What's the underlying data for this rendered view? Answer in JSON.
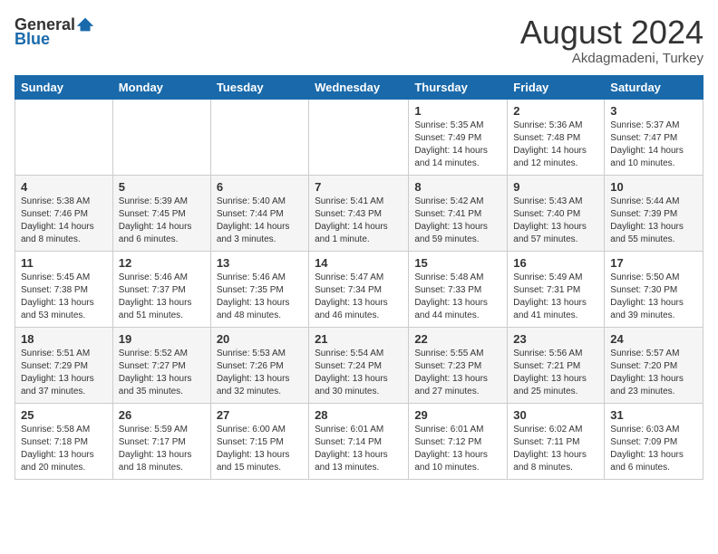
{
  "logo": {
    "text_general": "General",
    "text_blue": "Blue"
  },
  "title": {
    "month_year": "August 2024",
    "location": "Akdagmadeni, Turkey"
  },
  "weekdays": [
    "Sunday",
    "Monday",
    "Tuesday",
    "Wednesday",
    "Thursday",
    "Friday",
    "Saturday"
  ],
  "weeks": [
    [
      {
        "day": "",
        "sunrise": "",
        "sunset": "",
        "daylight": ""
      },
      {
        "day": "",
        "sunrise": "",
        "sunset": "",
        "daylight": ""
      },
      {
        "day": "",
        "sunrise": "",
        "sunset": "",
        "daylight": ""
      },
      {
        "day": "",
        "sunrise": "",
        "sunset": "",
        "daylight": ""
      },
      {
        "day": "1",
        "sunrise": "Sunrise: 5:35 AM",
        "sunset": "Sunset: 7:49 PM",
        "daylight": "Daylight: 14 hours and 14 minutes."
      },
      {
        "day": "2",
        "sunrise": "Sunrise: 5:36 AM",
        "sunset": "Sunset: 7:48 PM",
        "daylight": "Daylight: 14 hours and 12 minutes."
      },
      {
        "day": "3",
        "sunrise": "Sunrise: 5:37 AM",
        "sunset": "Sunset: 7:47 PM",
        "daylight": "Daylight: 14 hours and 10 minutes."
      }
    ],
    [
      {
        "day": "4",
        "sunrise": "Sunrise: 5:38 AM",
        "sunset": "Sunset: 7:46 PM",
        "daylight": "Daylight: 14 hours and 8 minutes."
      },
      {
        "day": "5",
        "sunrise": "Sunrise: 5:39 AM",
        "sunset": "Sunset: 7:45 PM",
        "daylight": "Daylight: 14 hours and 6 minutes."
      },
      {
        "day": "6",
        "sunrise": "Sunrise: 5:40 AM",
        "sunset": "Sunset: 7:44 PM",
        "daylight": "Daylight: 14 hours and 3 minutes."
      },
      {
        "day": "7",
        "sunrise": "Sunrise: 5:41 AM",
        "sunset": "Sunset: 7:43 PM",
        "daylight": "Daylight: 14 hours and 1 minute."
      },
      {
        "day": "8",
        "sunrise": "Sunrise: 5:42 AM",
        "sunset": "Sunset: 7:41 PM",
        "daylight": "Daylight: 13 hours and 59 minutes."
      },
      {
        "day": "9",
        "sunrise": "Sunrise: 5:43 AM",
        "sunset": "Sunset: 7:40 PM",
        "daylight": "Daylight: 13 hours and 57 minutes."
      },
      {
        "day": "10",
        "sunrise": "Sunrise: 5:44 AM",
        "sunset": "Sunset: 7:39 PM",
        "daylight": "Daylight: 13 hours and 55 minutes."
      }
    ],
    [
      {
        "day": "11",
        "sunrise": "Sunrise: 5:45 AM",
        "sunset": "Sunset: 7:38 PM",
        "daylight": "Daylight: 13 hours and 53 minutes."
      },
      {
        "day": "12",
        "sunrise": "Sunrise: 5:46 AM",
        "sunset": "Sunset: 7:37 PM",
        "daylight": "Daylight: 13 hours and 51 minutes."
      },
      {
        "day": "13",
        "sunrise": "Sunrise: 5:46 AM",
        "sunset": "Sunset: 7:35 PM",
        "daylight": "Daylight: 13 hours and 48 minutes."
      },
      {
        "day": "14",
        "sunrise": "Sunrise: 5:47 AM",
        "sunset": "Sunset: 7:34 PM",
        "daylight": "Daylight: 13 hours and 46 minutes."
      },
      {
        "day": "15",
        "sunrise": "Sunrise: 5:48 AM",
        "sunset": "Sunset: 7:33 PM",
        "daylight": "Daylight: 13 hours and 44 minutes."
      },
      {
        "day": "16",
        "sunrise": "Sunrise: 5:49 AM",
        "sunset": "Sunset: 7:31 PM",
        "daylight": "Daylight: 13 hours and 41 minutes."
      },
      {
        "day": "17",
        "sunrise": "Sunrise: 5:50 AM",
        "sunset": "Sunset: 7:30 PM",
        "daylight": "Daylight: 13 hours and 39 minutes."
      }
    ],
    [
      {
        "day": "18",
        "sunrise": "Sunrise: 5:51 AM",
        "sunset": "Sunset: 7:29 PM",
        "daylight": "Daylight: 13 hours and 37 minutes."
      },
      {
        "day": "19",
        "sunrise": "Sunrise: 5:52 AM",
        "sunset": "Sunset: 7:27 PM",
        "daylight": "Daylight: 13 hours and 35 minutes."
      },
      {
        "day": "20",
        "sunrise": "Sunrise: 5:53 AM",
        "sunset": "Sunset: 7:26 PM",
        "daylight": "Daylight: 13 hours and 32 minutes."
      },
      {
        "day": "21",
        "sunrise": "Sunrise: 5:54 AM",
        "sunset": "Sunset: 7:24 PM",
        "daylight": "Daylight: 13 hours and 30 minutes."
      },
      {
        "day": "22",
        "sunrise": "Sunrise: 5:55 AM",
        "sunset": "Sunset: 7:23 PM",
        "daylight": "Daylight: 13 hours and 27 minutes."
      },
      {
        "day": "23",
        "sunrise": "Sunrise: 5:56 AM",
        "sunset": "Sunset: 7:21 PM",
        "daylight": "Daylight: 13 hours and 25 minutes."
      },
      {
        "day": "24",
        "sunrise": "Sunrise: 5:57 AM",
        "sunset": "Sunset: 7:20 PM",
        "daylight": "Daylight: 13 hours and 23 minutes."
      }
    ],
    [
      {
        "day": "25",
        "sunrise": "Sunrise: 5:58 AM",
        "sunset": "Sunset: 7:18 PM",
        "daylight": "Daylight: 13 hours and 20 minutes."
      },
      {
        "day": "26",
        "sunrise": "Sunrise: 5:59 AM",
        "sunset": "Sunset: 7:17 PM",
        "daylight": "Daylight: 13 hours and 18 minutes."
      },
      {
        "day": "27",
        "sunrise": "Sunrise: 6:00 AM",
        "sunset": "Sunset: 7:15 PM",
        "daylight": "Daylight: 13 hours and 15 minutes."
      },
      {
        "day": "28",
        "sunrise": "Sunrise: 6:01 AM",
        "sunset": "Sunset: 7:14 PM",
        "daylight": "Daylight: 13 hours and 13 minutes."
      },
      {
        "day": "29",
        "sunrise": "Sunrise: 6:01 AM",
        "sunset": "Sunset: 7:12 PM",
        "daylight": "Daylight: 13 hours and 10 minutes."
      },
      {
        "day": "30",
        "sunrise": "Sunrise: 6:02 AM",
        "sunset": "Sunset: 7:11 PM",
        "daylight": "Daylight: 13 hours and 8 minutes."
      },
      {
        "day": "31",
        "sunrise": "Sunrise: 6:03 AM",
        "sunset": "Sunset: 7:09 PM",
        "daylight": "Daylight: 13 hours and 6 minutes."
      }
    ]
  ]
}
